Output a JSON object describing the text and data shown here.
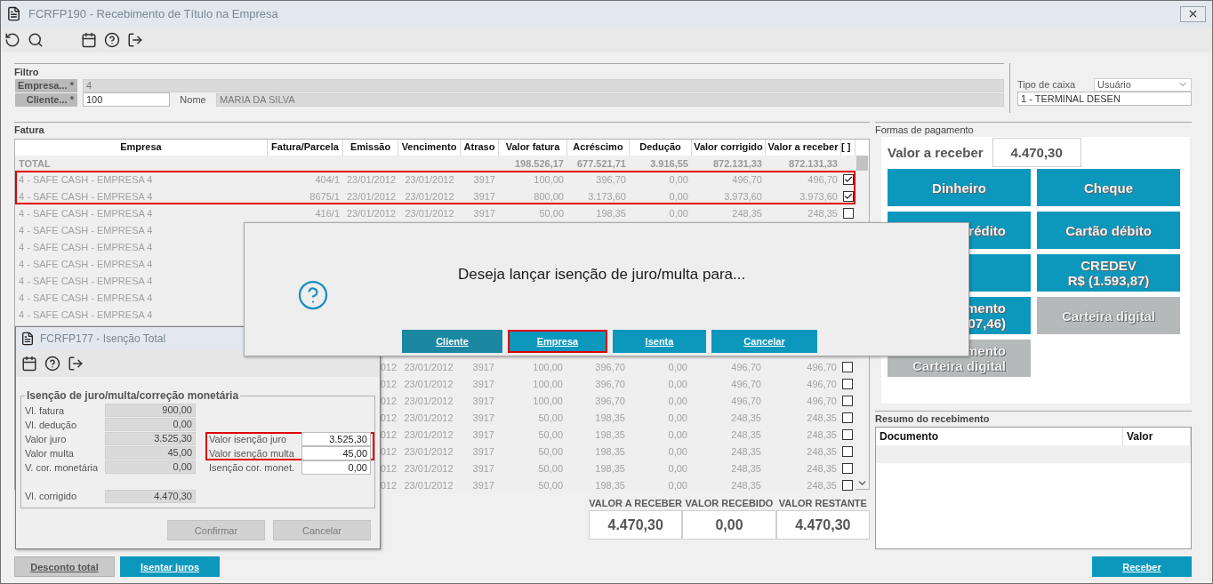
{
  "window": {
    "title": "FCRFP190 - Recebimento de Título na Empresa"
  },
  "filter": {
    "title": "Filtro",
    "empresa_label": "Empresa... *",
    "empresa_value": "4",
    "cliente_label": "Cliente... *",
    "cliente_value": "100",
    "nome_label": "Nome",
    "nome_value": "MARIA DA SILVA"
  },
  "caixa": {
    "label": "Tipo de caixa",
    "select_value": "Usuário",
    "terminal": "1 - TERMINAL DESEN"
  },
  "fatura": {
    "title": "Fatura",
    "columns": [
      "Empresa",
      "Fatura/Parcela",
      "Emissão",
      "Vencimento",
      "Atraso",
      "Valor fatura",
      "Acréscimo",
      "Dedução",
      "Valor corrigido",
      "Valor a receber",
      "[ ]"
    ],
    "total": {
      "empresa": "TOTAL",
      "valor_fatura": "198.526,17",
      "acrescimo": "677.521,71",
      "deducao": "3.916,55",
      "valor_corrigido": "872.131,33",
      "valor_a_receber": "872.131,33"
    },
    "rows": [
      {
        "empresa": "4 - SAFE CASH -  EMPRESA 4",
        "fatura_parcela": "404/1",
        "emissao": "23/01/2012",
        "vencimento": "23/01/2012",
        "atraso": "3917",
        "valor_fatura": "100,00",
        "acrescimo": "396,70",
        "deducao": "0,00",
        "valor_corrigido": "496,70",
        "valor_a_receber": "496,70",
        "checked": true,
        "highlighted": true
      },
      {
        "empresa": "4 - SAFE CASH -  EMPRESA 4",
        "fatura_parcela": "8675/1",
        "emissao": "23/01/2012",
        "vencimento": "23/01/2012",
        "atraso": "3917",
        "valor_fatura": "800,00",
        "acrescimo": "3.173,60",
        "deducao": "0,00",
        "valor_corrigido": "3.973,60",
        "valor_a_receber": "3.973,60",
        "checked": true,
        "highlighted": true
      },
      {
        "empresa": "4 - SAFE CASH -  EMPRESA 4",
        "fatura_parcela": "416/1",
        "emissao": "23/01/2012",
        "vencimento": "23/01/2012",
        "atraso": "3917",
        "valor_fatura": "50,00",
        "acrescimo": "198,35",
        "deducao": "0,00",
        "valor_corrigido": "248,35",
        "valor_a_receber": "248,35",
        "checked": false,
        "highlighted": false
      },
      {
        "empresa": "4 - SAFE CASH -  EMPRESA 4",
        "highlighted": false
      },
      {
        "empresa": "4 - SAFE CASH -  EMPRESA 4",
        "highlighted": false
      },
      {
        "empresa": "4 - SAFE CASH -  EMPRESA 4",
        "highlighted": false
      },
      {
        "empresa": "4 - SAFE CASH -  EMPRESA 4",
        "highlighted": false
      },
      {
        "empresa": "4 - SAFE CASH -  EMPRESA 4",
        "highlighted": false
      },
      {
        "empresa": "4 - SAFE CASH -  EMPRESA 4",
        "highlighted": false
      }
    ],
    "rows_below_dialog": [
      {
        "emissao": "012",
        "vencimento": "23/01/2012",
        "atraso": "3917",
        "valor_fatura": "100,00",
        "acrescimo": "396,70",
        "deducao": "0,00",
        "valor_corrigido": "496,70",
        "valor_a_receber": "496,70",
        "checked": false
      },
      {
        "emissao": "012",
        "vencimento": "23/01/2012",
        "atraso": "3917",
        "valor_fatura": "100,00",
        "acrescimo": "396,70",
        "deducao": "0,00",
        "valor_corrigido": "496,70",
        "valor_a_receber": "496,70",
        "checked": false
      },
      {
        "emissao": "012",
        "vencimento": "23/01/2012",
        "atraso": "3917",
        "valor_fatura": "100,00",
        "acrescimo": "396,70",
        "deducao": "0,00",
        "valor_corrigido": "496,70",
        "valor_a_receber": "496,70",
        "checked": false
      },
      {
        "emissao": "012",
        "vencimento": "23/01/2012",
        "atraso": "3917",
        "valor_fatura": "50,00",
        "acrescimo": "198,35",
        "deducao": "0,00",
        "valor_corrigido": "248,35",
        "valor_a_receber": "248,35",
        "checked": false
      },
      {
        "emissao": "012",
        "vencimento": "23/01/2012",
        "atraso": "3917",
        "valor_fatura": "50,00",
        "acrescimo": "198,35",
        "deducao": "0,00",
        "valor_corrigido": "248,35",
        "valor_a_receber": "248,35",
        "checked": false
      },
      {
        "emissao": "012",
        "vencimento": "23/01/2012",
        "atraso": "3917",
        "valor_fatura": "50,00",
        "acrescimo": "198,35",
        "deducao": "0,00",
        "valor_corrigido": "248,35",
        "valor_a_receber": "248,35",
        "checked": false
      },
      {
        "emissao": "012",
        "vencimento": "23/01/2012",
        "atraso": "3917",
        "valor_fatura": "50,00",
        "acrescimo": "198,35",
        "deducao": "0,00",
        "valor_corrigido": "248,35",
        "valor_a_receber": "248,35",
        "checked": false
      },
      {
        "emissao": "012",
        "vencimento": "23/01/2012",
        "atraso": "3917",
        "valor_fatura": "50,00",
        "acrescimo": "198,35",
        "deducao": "0,00",
        "valor_corrigido": "248,35",
        "valor_a_receber": "248,35",
        "checked": false
      }
    ]
  },
  "totals": [
    {
      "label": "VALOR A RECEBER",
      "value": "4.470,30"
    },
    {
      "label": "VALOR RECEBIDO",
      "value": "0,00"
    },
    {
      "label": "VALOR RESTANTE",
      "value": "4.470,30"
    }
  ],
  "payment": {
    "title": "Formas de pagamento",
    "amount_label": "Valor a receber",
    "amount": "4.470,30",
    "methods": [
      {
        "lines": [
          "Dinheiro"
        ],
        "disabled": false,
        "covered": false
      },
      {
        "lines": [
          "Cheque"
        ],
        "disabled": false,
        "covered": false
      },
      {
        "lines": [
          "rédito"
        ],
        "disabled": false,
        "covered": true
      },
      {
        "lines": [
          "Cartão débito"
        ],
        "disabled": false,
        "covered": false
      },
      {
        "disabled": false
      },
      {
        "lines": [
          "CREDEV",
          "R$ (1.593,87)"
        ],
        "disabled": false,
        "covered": false
      },
      {
        "lines": [
          "mento",
          "07,46)"
        ],
        "disabled": false,
        "covered": true
      },
      {
        "lines": [
          "Carteira digital"
        ],
        "disabled": true,
        "covered": false
      },
      {
        "lines": [
          "mento",
          "Carteira digital"
        ],
        "disabled": true,
        "covered": true
      }
    ]
  },
  "summary": {
    "title": "Resumo do recebimento",
    "columns": [
      "Documento",
      "Valor"
    ]
  },
  "bottom_buttons": [
    {
      "label": "Desconto total",
      "disabled": true
    },
    {
      "label": "Isentar juros",
      "disabled": false
    },
    {
      "label": "Receber",
      "disabled": false
    }
  ],
  "dialog": {
    "message": "Deseja lançar isenção de juro/multa para...",
    "buttons": [
      {
        "label": "Cliente",
        "focused": true,
        "highlighted": false
      },
      {
        "label": "Empresa",
        "focused": false,
        "highlighted": true
      },
      {
        "label": "Isenta",
        "focused": false,
        "highlighted": false
      },
      {
        "label": "Cancelar",
        "focused": false,
        "highlighted": false
      }
    ]
  },
  "exemption_window": {
    "title": "FCRFP177 - Isenção Total",
    "group": "Isenção de juro/multa/correção monetária",
    "fields": [
      {
        "label": "Vl. fatura",
        "value": "900,00"
      },
      {
        "label": "Vl. dedução",
        "value": "0,00"
      },
      {
        "label": "Valor juro",
        "value": "3.525,30"
      },
      {
        "label": "Valor multa",
        "value": "45,00"
      },
      {
        "label": "V. cor. monetária",
        "value": "0,00"
      }
    ],
    "corrected": {
      "label": "Vl. corrigido",
      "value": "4.470,30"
    },
    "exemptions": [
      {
        "label": "Valor isenção juro",
        "value": "3.525,30",
        "highlighted": true
      },
      {
        "label": "Valor isenção multa",
        "value": "45,00",
        "highlighted": true
      },
      {
        "label": "Isenção cor. monet.",
        "value": "0,00",
        "highlighted": false
      }
    ],
    "buttons": [
      {
        "label": "Confirmar",
        "disabled": true
      },
      {
        "label": "Cancelar",
        "disabled": true
      }
    ]
  }
}
